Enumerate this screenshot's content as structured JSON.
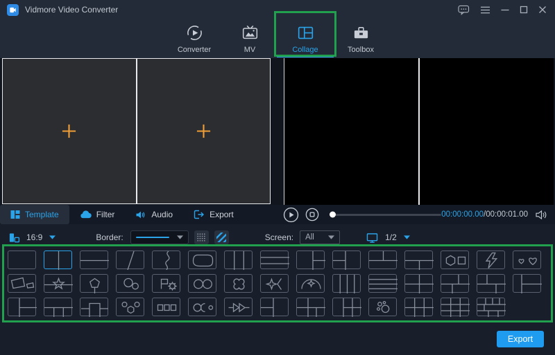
{
  "window": {
    "title": "Vidmore Video Converter",
    "icon": "app-logo-icon",
    "controls": [
      {
        "name": "feedback-icon"
      },
      {
        "name": "menu-icon"
      },
      {
        "name": "minimize-icon"
      },
      {
        "name": "maximize-icon"
      },
      {
        "name": "close-icon"
      }
    ]
  },
  "nav": {
    "tabs": [
      {
        "label": "Converter",
        "icon": "converter-icon",
        "active": false
      },
      {
        "label": "MV",
        "icon": "mv-icon",
        "active": false
      },
      {
        "label": "Collage",
        "icon": "collage-icon",
        "active": true
      },
      {
        "label": "Toolbox",
        "icon": "toolbox-icon",
        "active": false
      }
    ]
  },
  "editor": {
    "cells": [
      {
        "icon": "add-video-icon"
      },
      {
        "icon": "add-video-icon"
      }
    ]
  },
  "preview": {
    "cells": 2
  },
  "panel_tabs": [
    {
      "label": "Template",
      "icon": "template-icon",
      "active": true
    },
    {
      "label": "Filter",
      "icon": "filter-icon",
      "active": false
    },
    {
      "label": "Audio",
      "icon": "audio-icon",
      "active": false
    },
    {
      "label": "Export",
      "icon": "export-tab-icon",
      "active": false
    }
  ],
  "player": {
    "buttons": [
      {
        "name": "play-icon"
      },
      {
        "name": "stop-icon"
      }
    ],
    "progress_percent": 0,
    "current_time": "00:00:00.00",
    "separator": "/",
    "total_time": "00:00:01.00",
    "volume_icon": "volume-icon"
  },
  "toolbar": {
    "aspect_icon": "aspect-ratio-icon",
    "aspect_value": "16:9",
    "border_label": "Border:",
    "border_style": "solid-line",
    "pattern_buttons": [
      {
        "name": "dots-pattern-icon"
      },
      {
        "name": "stripes-pattern-icon"
      }
    ],
    "screen_label": "Screen:",
    "screen_value": "All",
    "page_icon": "monitor-icon",
    "page_value": "1/2"
  },
  "templates": {
    "selected": {
      "row": 0,
      "col": 1
    },
    "rows": [
      [
        "single",
        "split-v",
        "split-h",
        "diagonal",
        "wave-v",
        "rounded-inset",
        "cols-3",
        "rows-3",
        "left-big-right-2rows",
        "left-2rows-right-big",
        "top-2cols-bottom-big",
        "top-big-bottom-2cols",
        "hex-square",
        "lightning",
        "hearts"
      ],
      [
        "skew-quads",
        "star-line",
        "pentagon-line",
        "circles-big-small",
        "flag-gear",
        "circles-two",
        "clover",
        "star-bracket",
        "dome-clover",
        "cols-4",
        "rows-4",
        "grid-2x2",
        "grid-2x2-offset",
        "grid-asym",
        "leftcol-2cells"
      ],
      [
        "left-cell-right-2rows",
        "top-big-bottom-3cols",
        "podium",
        "circles-hex",
        "squares-3",
        "circle-half-dot",
        "arrows",
        "left-2rows-right-big",
        "grid-5cell",
        "left-col-right-grid",
        "bubbles",
        "grid-3x2",
        "grid-3x3",
        "grid-brick"
      ]
    ]
  },
  "export_button": {
    "label": "Export"
  },
  "annotations": {
    "color": "#21A14D",
    "boxes": [
      "collage-tab",
      "template-grid"
    ]
  },
  "colors": {
    "accent_blue": "#2BA3E8",
    "export_blue": "#1F9BF0",
    "plus_orange": "#F09E37",
    "annotation_green": "#21A14D",
    "titlebar_bg": "#232B38",
    "panel_bg": "#181E2A",
    "cell_bg": "#2B2D30",
    "preview_bg": "#000000"
  }
}
